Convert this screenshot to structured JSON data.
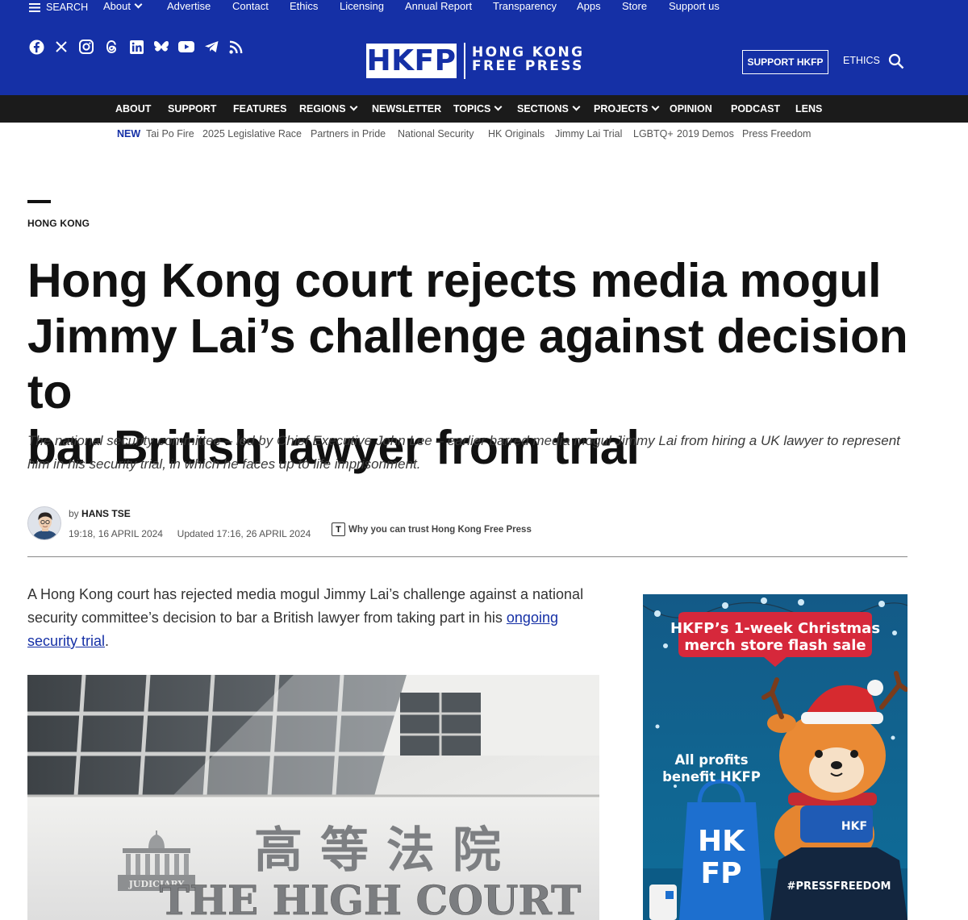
{
  "topbar": {
    "search_label": "SEARCH",
    "links": [
      "About",
      "Advertise",
      "Contact",
      "Ethics",
      "Licensing",
      "Annual Report",
      "Transparency",
      "Apps",
      "Store",
      "Support us"
    ]
  },
  "header": {
    "social_icons": [
      "facebook-icon",
      "x-icon",
      "instagram-icon",
      "threads-icon",
      "linkedin-icon",
      "bluesky-icon",
      "youtube-icon",
      "telegram-icon",
      "rss-icon"
    ],
    "logo_mark": "HKFP",
    "logo_line1": "HONG KONG",
    "logo_line2": "FREE PRESS",
    "support_button": "SUPPORT HKFP",
    "ethics_link": "ETHICS"
  },
  "nav": {
    "items": [
      "ABOUT",
      "SUPPORT",
      "FEATURES",
      "REGIONS",
      "NEWSLETTER",
      "TOPICS",
      "SECTIONS",
      "PROJECTS",
      "OPINION",
      "PODCAST",
      "LENS"
    ]
  },
  "trending": {
    "new_label": "NEW",
    "items": [
      "Tai Po Fire",
      "2025 Legislative Race",
      "Partners in Pride",
      "National Security",
      "HK Originals",
      "Jimmy Lai Trial",
      "LGBTQ+",
      "2019 Demos",
      "Press Freedom"
    ]
  },
  "article": {
    "category": "HONG KONG",
    "headline_lines": [
      "Hong Kong court rejects media mogul",
      "Jimmy Lai’s challenge against decision to",
      "bar British lawyer from trial"
    ],
    "dek_lines": [
      "The national security committee – led by Chief Executive John Lee – earlier barred media mogul Jimmy Lai from hiring a UK lawyer to represent",
      "him in his security trial, in which he faces up to life imprisonment."
    ],
    "by": "by",
    "author": "HANS TSE",
    "published": "19:18, 16 APRIL 2024",
    "updated": "Updated 17:16, 26 APRIL 2024",
    "trust_text": "Why you can trust Hong Kong Free Press",
    "lede_line1": "A Hong Kong court has rejected media mogul Jimmy Lai’s challenge against a national",
    "lede_line2_pre": "security committee’s decision to bar a British lawyer from taking part in his ",
    "lede_link_part1": "ongoing",
    "lede_link_part2": "security trial",
    "lede_end": ".",
    "photo_sign_chinese": "高等法院",
    "photo_sign_english": "THE HIGH COURT",
    "photo_emblem_text": "JUDICIARY"
  },
  "ad": {
    "headline_line1": "HKFP’s 1-week Christmas",
    "headline_line2": "merch store flash sale",
    "sub_line1": "All profits",
    "sub_line2": "benefit HKFP",
    "bag_text_1": "HK",
    "bag_text_2": "FP",
    "shirt_text": "#PRESSFREEDOM",
    "scarf_text": "HKF",
    "colors": {
      "background": "#135a87",
      "bubble_red": "#d6283b"
    }
  },
  "colors": {
    "brand_blue": "#1530a6",
    "nav_black": "#1b1b1b"
  }
}
